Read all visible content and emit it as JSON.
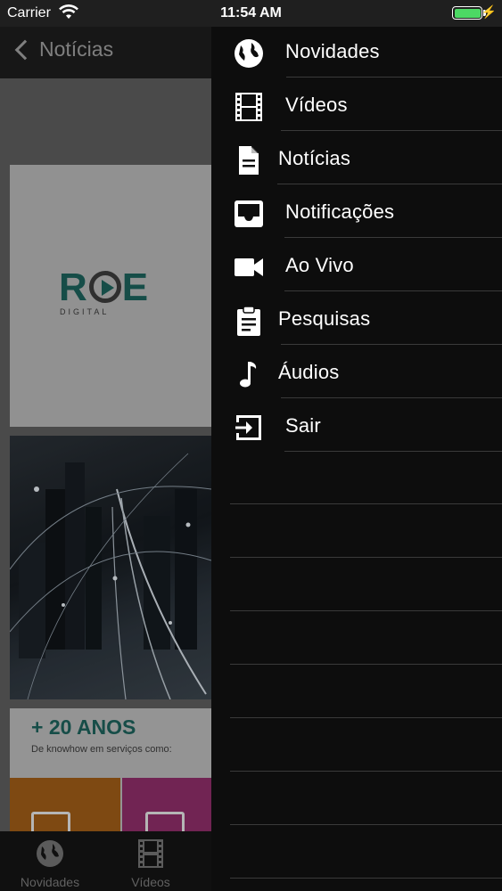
{
  "status_bar": {
    "carrier": "Carrier",
    "time": "11:54 AM"
  },
  "nav_bar": {
    "back_label": "Notícias"
  },
  "cards": {
    "logo_text": "RCE",
    "logo_sub": "DIGITAL",
    "years_title": "+ 20 ANOS",
    "years_sub": "De knowhow em serviços como:"
  },
  "tab_bar": {
    "tabs": [
      {
        "label": "Novidades",
        "icon": "globe-icon"
      },
      {
        "label": "Vídeos",
        "icon": "film-icon"
      }
    ]
  },
  "menu": {
    "items": [
      {
        "label": "Novidades",
        "icon": "globe-icon"
      },
      {
        "label": "Vídeos",
        "icon": "film-icon"
      },
      {
        "label": "Notícias",
        "icon": "document-icon"
      },
      {
        "label": "Notificações",
        "icon": "inbox-icon"
      },
      {
        "label": "Ao Vivo",
        "icon": "video-camera-icon"
      },
      {
        "label": "Pesquisas",
        "icon": "clipboard-icon"
      },
      {
        "label": "Áudios",
        "icon": "music-note-icon"
      },
      {
        "label": "Sair",
        "icon": "sign-out-icon"
      }
    ]
  },
  "colors": {
    "brand_green": "#1b5f58",
    "battery_green": "#4cd964"
  }
}
